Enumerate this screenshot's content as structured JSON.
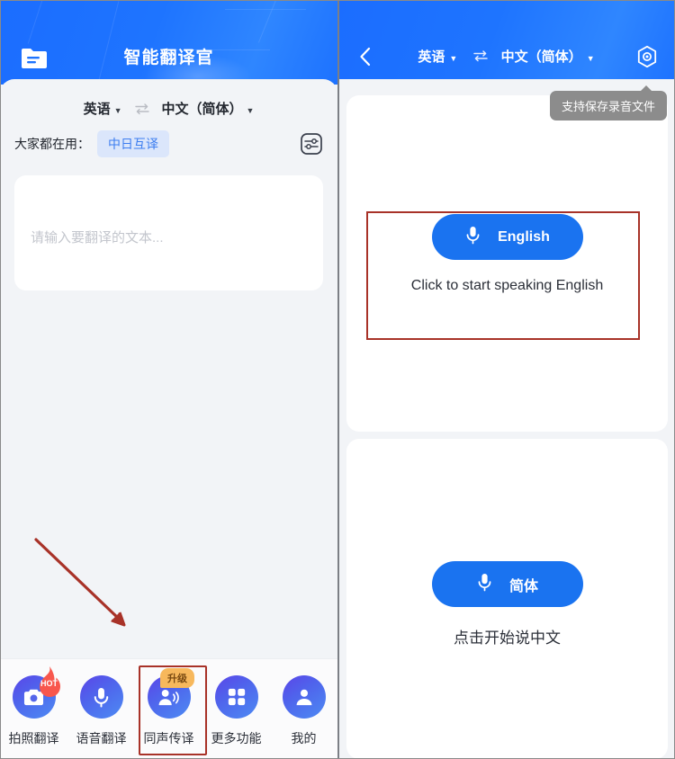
{
  "left": {
    "header": {
      "title": "智能翻译官",
      "folder_icon": "folder-document-icon"
    },
    "language_bar": {
      "source": "英语",
      "target": "中文（简体）",
      "swap_icon": "swap-arrows-icon",
      "caret": "▼"
    },
    "popular": {
      "label": "大家都在用：",
      "chip": "中日互译",
      "settings_icon": "sliders-icon"
    },
    "input": {
      "placeholder": "请输入要翻译的文本..."
    },
    "nav": [
      {
        "label": "拍照翻译",
        "icon": "camera-icon",
        "badge": "HOT",
        "badge_type": "flame"
      },
      {
        "label": "语音翻译",
        "icon": "microphone-icon",
        "badge": "",
        "badge_type": ""
      },
      {
        "label": "同声传译",
        "icon": "person-speaking-icon",
        "badge": "升级",
        "badge_type": "pill"
      },
      {
        "label": "更多功能",
        "icon": "grid-apps-icon",
        "badge": "",
        "badge_type": ""
      },
      {
        "label": "我的",
        "icon": "user-profile-icon",
        "badge": "",
        "badge_type": ""
      }
    ],
    "annotations": {
      "arrow_color": "#a83228",
      "highlight_color": "#a83228"
    }
  },
  "right": {
    "header": {
      "back_icon": "chevron-left-icon",
      "source": "英语",
      "target": "中文（简体）",
      "swap_icon": "swap-arrows-icon",
      "caret": "▼",
      "settings_icon": "hex-gear-icon"
    },
    "tooltip": "支持保存录音文件",
    "top_card": {
      "button_label": "English",
      "mic_icon": "microphone-icon",
      "hint": "Click to start speaking English"
    },
    "bottom_card": {
      "button_label": "简体",
      "mic_icon": "microphone-icon",
      "hint": "点击开始说中文"
    }
  },
  "colors": {
    "brand_blue": "#1a73f0",
    "header_blue": "#1e74ff",
    "page_bg": "#f2f4f7",
    "chip_bg": "#dbe6fb",
    "chip_text": "#3d7ef0",
    "badge_orange": "#f7b85c",
    "annotation_red": "#a83228",
    "tooltip_bg": "#8c8c8c"
  }
}
